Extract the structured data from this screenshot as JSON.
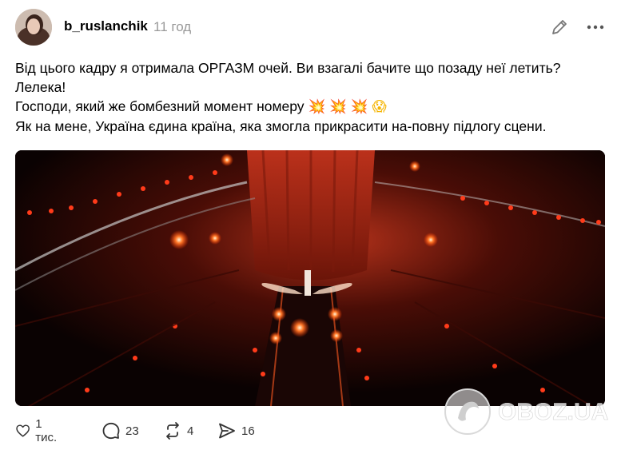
{
  "post": {
    "username": "b_ruslanchik",
    "time": "11 год",
    "caption_line1": "Від цього кадру я отримала ОРГАЗМ очей. Ви взагалі бачите що позаду неї летить? Лелека!",
    "caption_line2": "Господи, який же бомбезний момент номеру",
    "caption_line2_emojis": [
      "💥",
      "💥",
      "💥",
      "😱"
    ],
    "caption_line3": "Як на мене, Україна єдина країна, яка змогла прикрасити на-повну підлогу сцени."
  },
  "actions": {
    "likes": "1 тис.",
    "comments": "23",
    "reposts": "4",
    "shares": "16"
  },
  "watermark": {
    "text": "OBOZ.UA"
  },
  "icons": {
    "edit": "pencil-icon",
    "more": "more-horizontal-icon",
    "like": "heart-icon",
    "comment": "comment-bubble-icon",
    "repost": "repost-arrows-icon",
    "share": "send-arrow-icon"
  }
}
